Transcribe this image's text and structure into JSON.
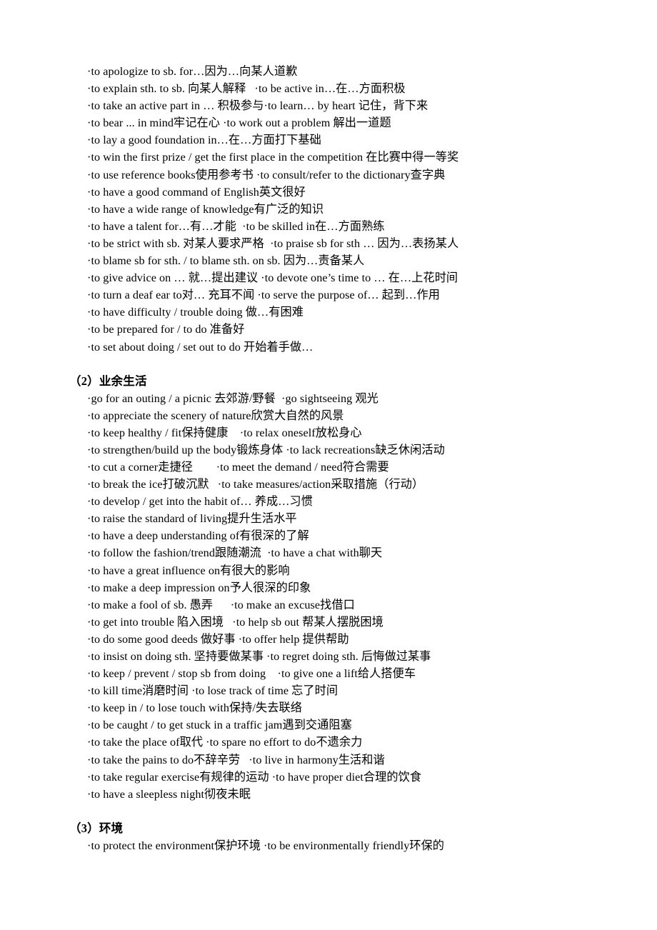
{
  "document": {
    "type": "phrase-reference-list",
    "language": "en-zh",
    "sections": [
      {
        "heading": null,
        "lines": [
          "·to apologize to sb. for…因为…向某人道歉",
          "·to explain sth. to sb. 向某人解释   ·to be active in…在…方面积极",
          "·to take an active part in … 积极参与·to learn… by heart 记住，背下来",
          "·to bear ... in mind牢记在心 ·to work out a problem 解出一道题",
          "·to lay a good foundation in…在…方面打下基础",
          "·to win the first prize / get the first place in the competition 在比赛中得一等奖",
          "·to use reference books使用参考书 ·to consult/refer to the dictionary查字典",
          "·to have a good command of English英文很好",
          "·to have a wide range of knowledge有广泛的知识",
          "·to have a talent for…有…才能  ·to be skilled in在…方面熟练",
          "·to be strict with sb. 对某人要求严格  ·to praise sb for sth … 因为…表扬某人",
          "·to blame sb for sth. / to blame sth. on sb. 因为…责备某人",
          "·to give advice on … 就…提出建议 ·to devote one’s time to … 在…上花时间",
          "·to turn a deaf ear to对… 充耳不闻 ·to serve the purpose of… 起到…作用",
          "·to have difficulty / trouble doing 做…有困难",
          "·to be prepared for / to do 准备好",
          "·to set about doing / set out to do 开始着手做…"
        ]
      },
      {
        "heading": "（2）业余生活",
        "lines": [
          "·go for an outing / a picnic 去郊游/野餐  ·go sightseeing 观光",
          "·to appreciate the scenery of nature欣赏大自然的风景",
          "·to keep healthy / fit保持健康    ·to relax oneself放松身心",
          "·to strengthen/build up the body锻炼身体 ·to lack recreations缺乏休闲活动",
          "·to cut a corner走捷径        ·to meet the demand / need符合需要",
          "·to break the ice打破沉默   ·to take measures/action采取措施（行动）",
          "·to develop / get into the habit of… 养成…习惯",
          "·to raise the standard of living提升生活水平",
          "·to have a deep understanding of有很深的了解",
          "·to follow the fashion/trend跟随潮流  ·to have a chat with聊天",
          "·to have a great influence on有很大的影响",
          "·to make a deep impression on予人很深的印象",
          "·to make a fool of sb. 愚弄      ·to make an excuse找借口",
          "·to get into trouble 陷入困境   ·to help sb out 帮某人摆脱困境",
          "·to do some good deeds 做好事 ·to offer help 提供帮助",
          "·to insist on doing sth. 坚持要做某事 ·to regret doing sth. 后悔做过某事",
          "·to keep / prevent / stop sb from doing    ·to give one a lift给人搭便车",
          "·to kill time消磨时间 ·to lose track of time 忘了时间",
          "·to keep in / to lose touch with保持/失去联络",
          "·to be caught / to get stuck in a traffic jam遇到交通阻塞",
          "·to take the place of取代 ·to spare no effort to do不遗余力",
          "·to take the pains to do不辞辛劳   ·to live in harmony生活和谐",
          "·to take regular exercise有规律的运动 ·to have proper diet合理的饮食",
          "·to have a sleepless night彻夜未眠"
        ]
      },
      {
        "heading": "（3）环境",
        "lines": [
          "·to protect the environment保护环境 ·to be environmentally friendly环保的"
        ]
      }
    ]
  }
}
